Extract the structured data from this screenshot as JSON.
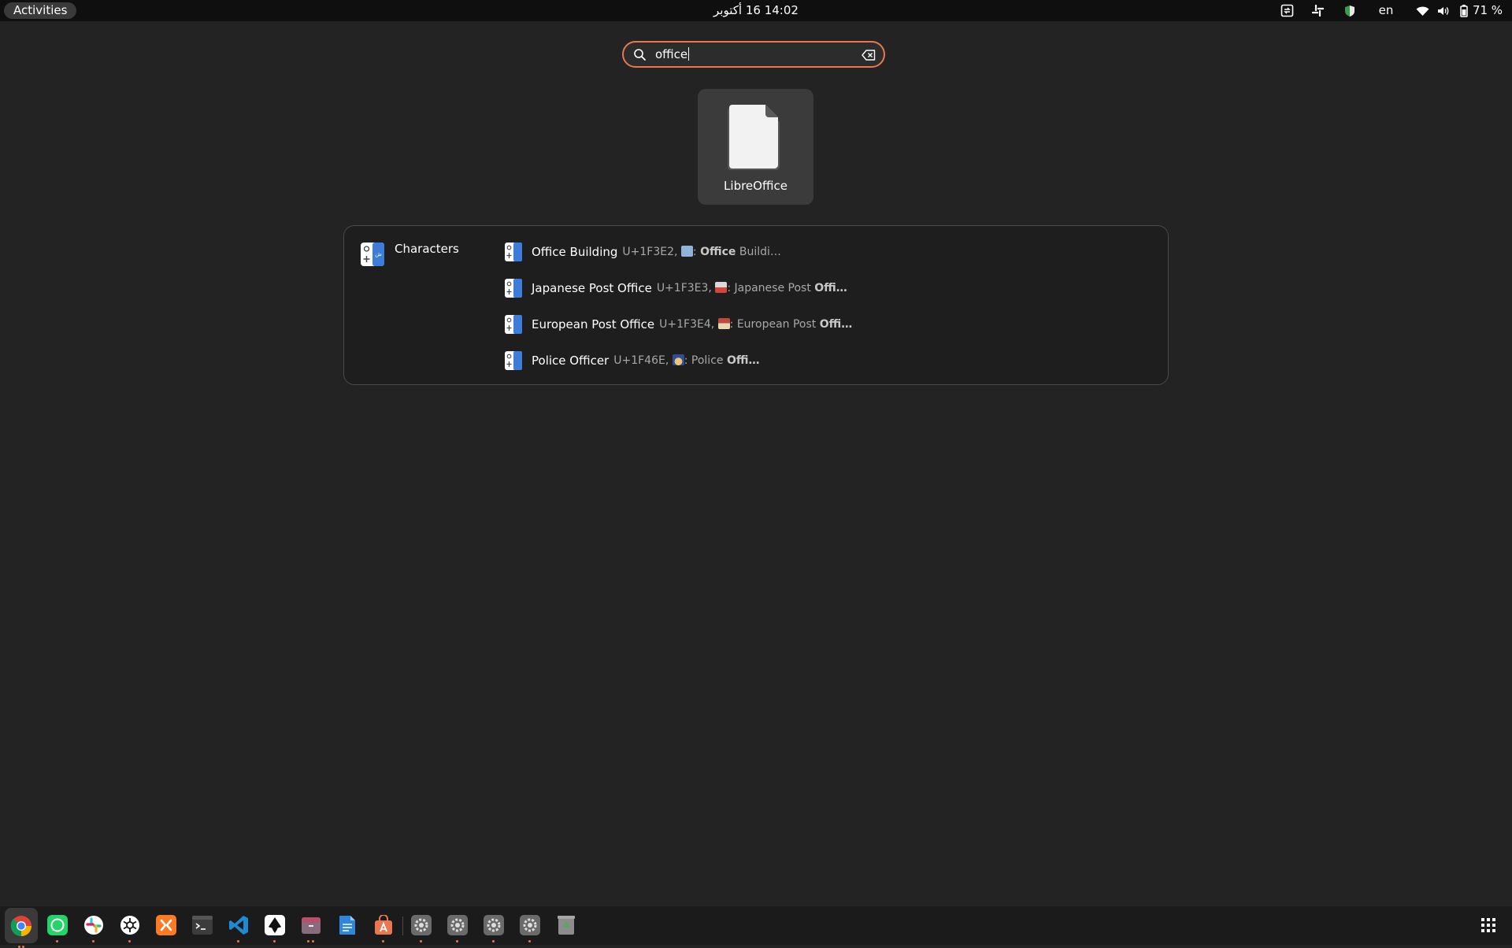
{
  "topbar": {
    "activities_label": "Activities",
    "clock_text": "14:02  16 أكتوبر",
    "language": "en",
    "battery_text": "71 %"
  },
  "search": {
    "value": "office",
    "icon": "search-icon",
    "clear_icon": "clear-text-icon"
  },
  "app_results": [
    {
      "label": "LibreOffice",
      "icon": "libreoffice-icon"
    }
  ],
  "provider": {
    "name": "Characters",
    "icon": "characters-app-icon",
    "results": [
      {
        "title": "Office Building",
        "desc_prefix": "U+1F3E2,",
        "desc_mid": ": ",
        "desc_bold1": "Office",
        "desc_tail": " Buildi…",
        "emoji": "office-building-emoji"
      },
      {
        "title": "Japanese Post Office",
        "desc_prefix": "U+1F3E3,",
        "desc_mid": ": Japanese Post ",
        "desc_bold1": "Offi…",
        "desc_tail": "",
        "emoji": "japanese-post-office-emoji"
      },
      {
        "title": "European Post Office",
        "desc_prefix": "U+1F3E4,",
        "desc_mid": ": European Post ",
        "desc_bold1": "Offi…",
        "desc_tail": "",
        "emoji": "european-post-office-emoji"
      },
      {
        "title": "Police Officer",
        "desc_prefix": "U+1F46E,",
        "desc_mid": ": Police ",
        "desc_bold1": "Offi…",
        "desc_tail": "",
        "emoji": "police-officer-emoji"
      }
    ]
  },
  "dock": {
    "apps": [
      "chrome",
      "whatsapp",
      "slack",
      "chatgpt",
      "xampp",
      "terminal",
      "vscode",
      "inkscape",
      "files-archive",
      "libreoffice-writer",
      "app-center",
      "settings-1",
      "settings-2",
      "settings-3",
      "settings-4",
      "trash"
    ]
  },
  "colors": {
    "accent": "#e9774f",
    "background": "#232323",
    "topbar": "#0f0f0f",
    "dock": "#1b1b1b"
  }
}
